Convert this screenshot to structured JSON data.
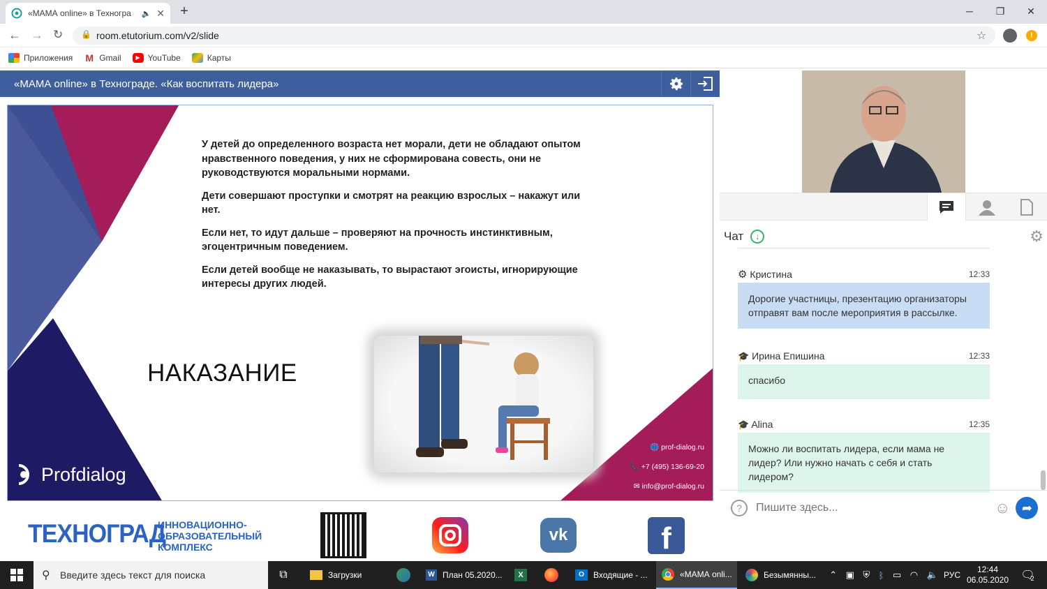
{
  "browser": {
    "tab_title": "«МАМА online» в Техногра",
    "url": "room.etutorium.com/v2/slide",
    "bookmarks": [
      {
        "label": "Приложения",
        "icon": "apps-grid-icon"
      },
      {
        "label": "Gmail",
        "icon": "gmail-icon"
      },
      {
        "label": "YouTube",
        "icon": "youtube-icon"
      },
      {
        "label": "Карты",
        "icon": "maps-icon"
      }
    ]
  },
  "app": {
    "title": "«МАМА online» в Технограде. «Как воспитать лидера»"
  },
  "slide": {
    "paragraphs": [
      "У детей до определенного возраста нет морали, дети не обладают опытом нравственного поведения, у них не сформирована совесть, они не руководствуются моральными нормами.",
      "Дети совершают проступки и смотрят на реакцию взрослых – накажут или нет.",
      "Если нет, то идут дальше – проверяют на прочность инстинктивным, эгоцентричным поведением.",
      "Если детей вообще не наказывать, то вырастают эгоисты, игнорирующие интересы других людей."
    ],
    "heading": "НАКАЗАНИЕ",
    "logo_text": "Profdialog",
    "contacts": {
      "site": "prof-dialog.ru",
      "phone": "+7 (495) 136-69-20",
      "email": "info@prof-dialog.ru"
    },
    "colors": {
      "navy": "#1e1a63",
      "crimson": "#a51c5a",
      "slate": "#4a5a9c"
    }
  },
  "banner": {
    "brand": "ТЕХНОГРАД",
    "subtitle_lines": [
      "ИННОВАЦИОННО-",
      "ОБРАЗОВАТЕЛЬНЫЙ",
      "КОМПЛЕКС"
    ],
    "socials": [
      "instagram-icon",
      "vk-icon",
      "facebook-icon"
    ]
  },
  "chat": {
    "title": "Чат",
    "messages": [
      {
        "author": "Кристина",
        "role_icon": "gear-icon",
        "time": "12:33",
        "text": "Дорогие участницы, презентацию организаторы отправят вам после мероприятия в рассылке.",
        "bubble": "#c8dcf3"
      },
      {
        "author": "Ирина Епишина",
        "role_icon": "graduation-cap-icon",
        "time": "12:33",
        "text": "спасибо",
        "bubble": "#ddf4ea"
      },
      {
        "author": "Alina",
        "role_icon": "graduation-cap-icon",
        "time": "12:35",
        "text": "Можно ли воспитать лидера, если мама не лидер? Или нужно начать с себя и стать лидером?",
        "bubble": "#ddf4ea"
      }
    ],
    "input_placeholder": "Пишите здесь..."
  },
  "taskbar": {
    "search_placeholder": "Введите здесь текст для поиска",
    "apps": [
      {
        "label": "Загрузки"
      },
      {
        "label": "План 05.2020..."
      },
      {
        "label": "Входящие - ..."
      },
      {
        "label": "«МАМА onli..."
      },
      {
        "label": "Безымянны..."
      }
    ],
    "lang": "РУС",
    "time": "12:44",
    "date": "06.05.2020",
    "notif_count": "2"
  }
}
